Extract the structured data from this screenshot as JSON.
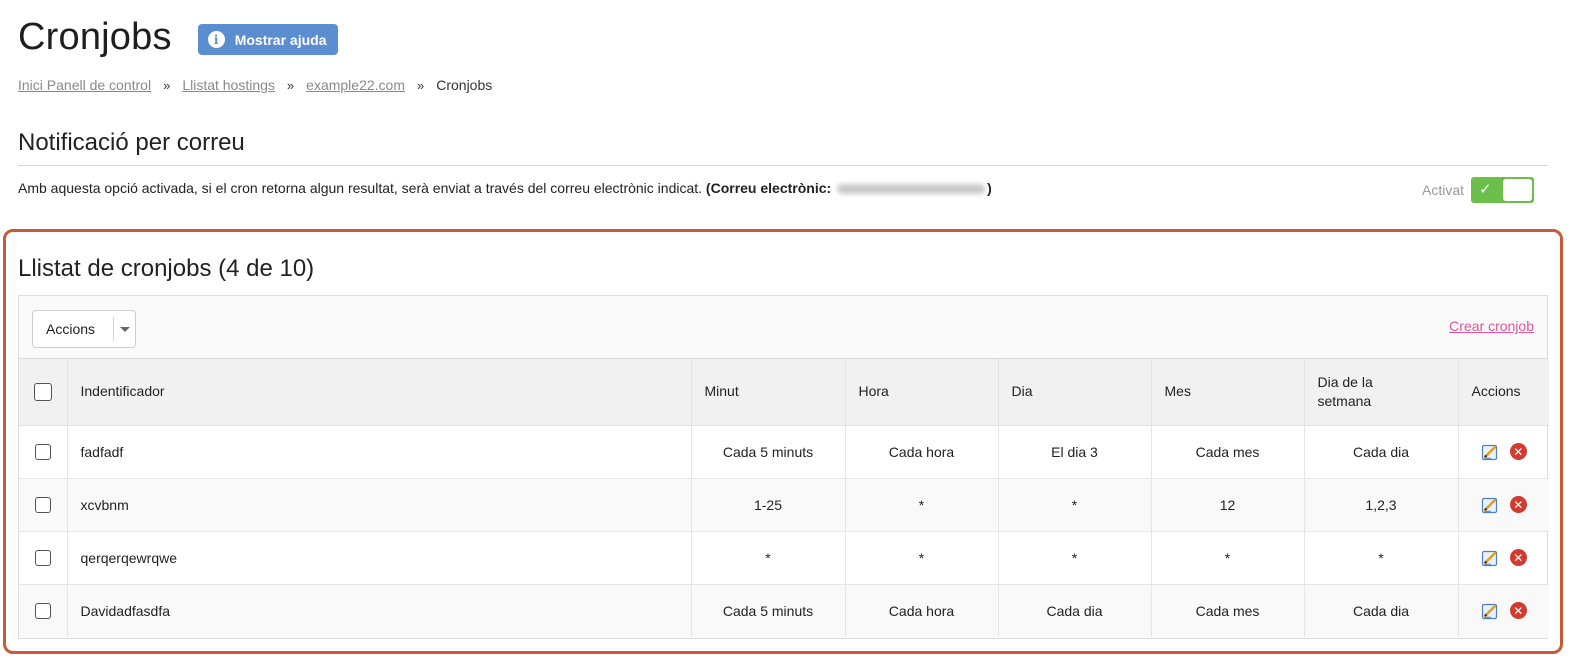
{
  "header": {
    "title": "Cronjobs",
    "help_button": "Mostrar ajuda"
  },
  "breadcrumb": {
    "items": [
      "Inici Panell de control",
      "Llistat hostings",
      "example22.com"
    ],
    "separator": "»",
    "current": "Cronjobs"
  },
  "notification": {
    "title": "Notificació per correu",
    "description": "Amb aquesta opció activada, si el cron retorna algun resultat, serà enviat a través del correu electrònic indicat.",
    "email_prefix": "(Correu electrònic:",
    "email_suffix": ")",
    "toggle_label": "Activat",
    "toggle_state": "on",
    "toggle_color": "#6cbf4b"
  },
  "cronjobs": {
    "title": "Llistat de cronjobs (4 de 10)",
    "actions_dropdown": "Accions",
    "create_link": "Crear cronjob",
    "columns": [
      "Indentificador",
      "Minut",
      "Hora",
      "Dia",
      "Mes",
      "Dia de la setmana",
      "Accions"
    ],
    "rows": [
      {
        "id": "fadfadf",
        "minute": "Cada 5 minuts",
        "hour": "Cada hora",
        "day": "El dia 3",
        "month": "Cada mes",
        "weekday": "Cada dia"
      },
      {
        "id": "xcvbnm",
        "minute": "1-25",
        "hour": "*",
        "day": "*",
        "month": "12",
        "weekday": "1,2,3"
      },
      {
        "id": "qerqerqewrqwe",
        "minute": "*",
        "hour": "*",
        "day": "*",
        "month": "*",
        "weekday": "*"
      },
      {
        "id": "Davidadfasdfa",
        "minute": "Cada 5 minuts",
        "hour": "Cada hora",
        "day": "Cada dia",
        "month": "Cada mes",
        "weekday": "Cada dia"
      }
    ],
    "row_icons": [
      "edit-icon",
      "delete-icon"
    ]
  },
  "colors": {
    "help_button": "#5b8ed0",
    "link_pink": "#e0559a",
    "highlight_border": "#c85a38",
    "delete_red": "#d23b2f"
  }
}
